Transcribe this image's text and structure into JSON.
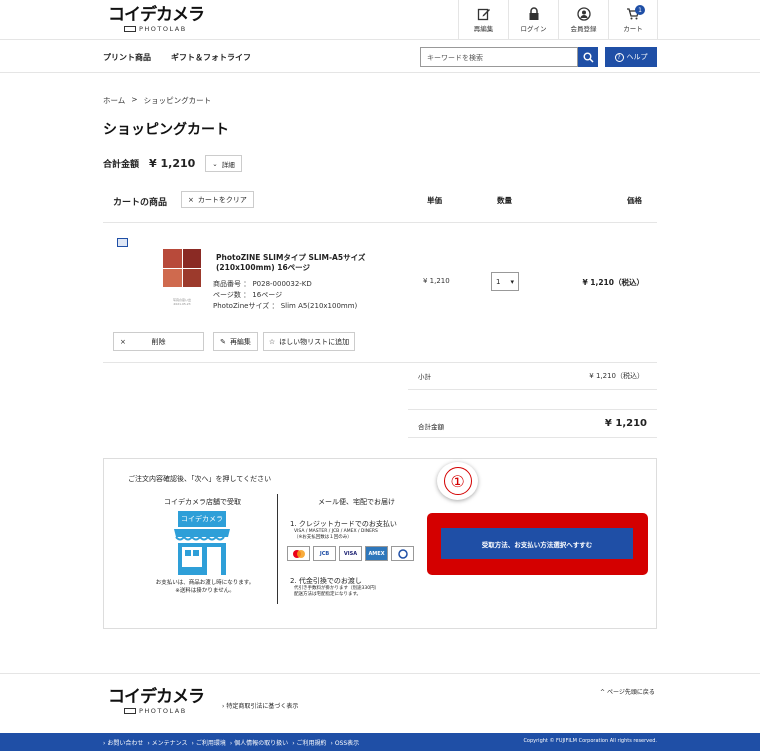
{
  "header": {
    "logo_main": "コイデカメラ",
    "logo_sub": "PHOTOLAB",
    "nav_buttons": [
      {
        "icon": "edit-icon",
        "label": "再編集"
      },
      {
        "icon": "lock-icon",
        "label": "ログイン"
      },
      {
        "icon": "user-icon",
        "label": "会員登録"
      },
      {
        "icon": "cart-icon",
        "label": "カート",
        "badge": "1"
      }
    ],
    "nav_items": [
      "プリント商品",
      "ギフト＆フォトライフ"
    ],
    "search_placeholder": "キーワードを検索",
    "help_label": "ヘルプ"
  },
  "breadcrumb": [
    "ホーム",
    ">",
    "ショッピングカート"
  ],
  "page_title": "ショッピングカート",
  "total": {
    "label": "合計金額",
    "value": "¥ 1,210",
    "detail_label": "詳細"
  },
  "cart": {
    "title": "カートの商品",
    "clear_label": "カートをクリア",
    "columns": {
      "unit_price": "単価",
      "qty": "数量",
      "price": "価格"
    },
    "item": {
      "name": "PhotoZINE SLIMタイプ SLIM-A5サイズ(210x100mm) 16ページ",
      "meta": [
        "商品番号 ： P028-000032-KD",
        "ページ数 ： 16ページ",
        "PhotoZineサイズ ： Slim A5(210x100mm)"
      ],
      "thumb_caption": "写真の思い出 2021.05.23",
      "unit_price": "¥ 1,210",
      "qty": "1",
      "price": "¥ 1,210（税込）",
      "actions": {
        "delete": "削除",
        "reedit": "再編集",
        "wishlist": "ほしい物リストに追加"
      }
    }
  },
  "summary": {
    "subtotal_label": "小計",
    "subtotal_value": "¥ 1,210（税込）",
    "grand_label": "合計金額",
    "grand_value": "¥ 1,210"
  },
  "instructions": {
    "title": "ご注文内容確認後、「次へ」を押してください",
    "store_title": "コイデカメラ店舗で受取",
    "store_sign": "コイデカメラ",
    "store_note": "お支払いは、商品お渡し時になります。\n※送料は掛かりません。",
    "mail_title": "メール便、宅配でお届け",
    "m1": "1. クレジットカードでのお支払い",
    "m1_sub": "VISA / MASTER / JCB / AMEX / DINERS\n（※お支払回数は１回のみ）",
    "cards": [
      "MC",
      "JCB",
      "VISA",
      "AMEX",
      "DC"
    ],
    "m2": "2. 代金引換でのお渡し",
    "m2_sub": "代引き手数料が掛かります（別途330円）\n配送方法は宅配指定になります。"
  },
  "step_number": "①",
  "cta_label": "受取方法、お支払い方法選択へすすむ",
  "footer": {
    "logo_main": "コイデカメラ",
    "logo_sub": "PHOTOLAB",
    "legal_link": "特定商取引法に基づく表示",
    "pagetop": "ページ先頭に戻る",
    "links": [
      "お問い合わせ",
      "メンテナンス",
      "ご利用環境",
      "個人情報の取り扱い",
      "ご利用規約",
      "OSS表示"
    ],
    "copyright": "Copyright © FUJIFILM Corporation All rights reserved."
  },
  "colors": {
    "brand_blue": "#1f4fa6",
    "highlight_red": "#d40000"
  }
}
